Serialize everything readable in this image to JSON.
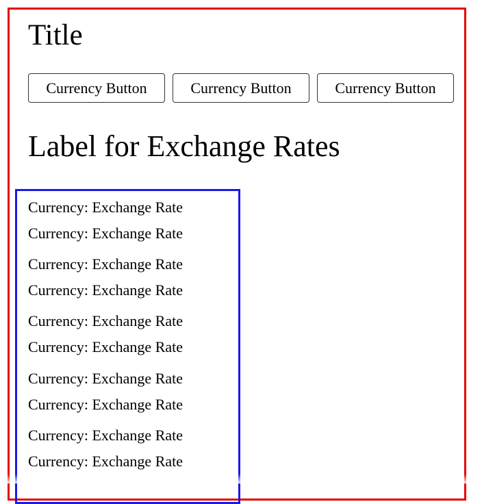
{
  "page": {
    "title": "Title",
    "section_label": "Label for Exchange Rates"
  },
  "buttons": [
    {
      "label": "Currency Button"
    },
    {
      "label": "Currency Button"
    },
    {
      "label": "Currency Button"
    }
  ],
  "rates": [
    {
      "text": "Currency: Exchange Rate"
    },
    {
      "text": "Currency: Exchange Rate"
    },
    {
      "text": "Currency: Exchange Rate"
    },
    {
      "text": "Currency: Exchange Rate"
    },
    {
      "text": "Currency: Exchange Rate"
    },
    {
      "text": "Currency: Exchange Rate"
    },
    {
      "text": "Currency: Exchange Rate"
    },
    {
      "text": "Currency: Exchange Rate"
    },
    {
      "text": "Currency: Exchange Rate"
    },
    {
      "text": "Currency: Exchange Rate"
    }
  ],
  "colors": {
    "outer_border": "#e50000",
    "rates_border": "#1a1ae6"
  }
}
